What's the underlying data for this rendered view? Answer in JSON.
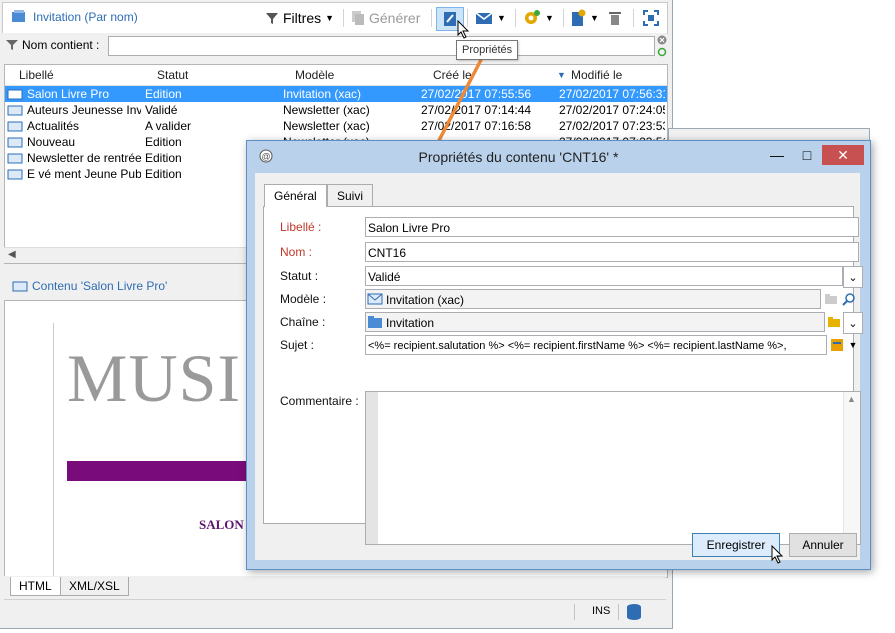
{
  "main": {
    "title": "Invitation (Par nom)",
    "toolbar": {
      "filters_label": "Filtres",
      "generate_label": "Générer",
      "tooltip": "Propriétés"
    },
    "filter": {
      "label": "Nom contient :",
      "value": ""
    },
    "grid": {
      "columns": [
        "Libellé",
        "Statut",
        "Modèle",
        "Créé le",
        "Modifié le"
      ],
      "rows": [
        {
          "label": "Salon Livre Pro",
          "status": "Edition",
          "model": "Invitation (xac)",
          "created": "27/02/2017 07:55:56",
          "modified": "27/02/2017 07:56:31"
        },
        {
          "label": "Auteurs Jeunesse Inv...",
          "status": "Validé",
          "model": "Newsletter (xac)",
          "created": "27/02/2017 07:14:44",
          "modified": "27/02/2017 07:24:05"
        },
        {
          "label": "Actualités",
          "status": "A valider",
          "model": "Newsletter (xac)",
          "created": "27/02/2017 07:16:58",
          "modified": "27/02/2017 07:23:53"
        },
        {
          "label": "Nouveau",
          "status": "Edition",
          "model": "Newsletter (xac)",
          "created": "",
          "modified": "27/02/2017 07:23:51"
        },
        {
          "label": "Newsletter de rentrée",
          "status": "Edition",
          "model": "",
          "created": "",
          "modified": ""
        },
        {
          "label": "E vé ment Jeune Pub...",
          "status": "Edition",
          "model": "",
          "created": "",
          "modified": ""
        }
      ]
    },
    "content": {
      "header": "Contenu 'Salon Livre Pro'",
      "preview_big": "MUSI",
      "preview_salon": "SALON"
    },
    "bottom_tabs": [
      "HTML",
      "XML/XSL"
    ],
    "status_ins": "INS"
  },
  "dialog": {
    "title": "Propriétés du contenu 'CNT16' *",
    "tabs": [
      "Général",
      "Suivi"
    ],
    "fields": {
      "libelle_label": "Libellé :",
      "libelle_value": "Salon Livre Pro",
      "nom_label": "Nom :",
      "nom_value": "CNT16",
      "statut_label": "Statut :",
      "statut_value": "Validé",
      "modele_label": "Modèle :",
      "modele_value": "Invitation (xac)",
      "chaine_label": "Chaîne :",
      "chaine_value": "Invitation",
      "sujet_label": "Sujet :",
      "sujet_value": "<%= recipient.salutation %> <%= recipient.firstName %> <%= recipient.lastName %>,",
      "commentaire_label": "Commentaire :"
    },
    "buttons": {
      "save": "Enregistrer",
      "cancel": "Annuler"
    }
  },
  "colors": {
    "accent": "#2e6db4",
    "selection": "#3399ff",
    "required": "#c0392b",
    "preview_bar": "#7a0b7a",
    "close_button": "#c75050"
  }
}
